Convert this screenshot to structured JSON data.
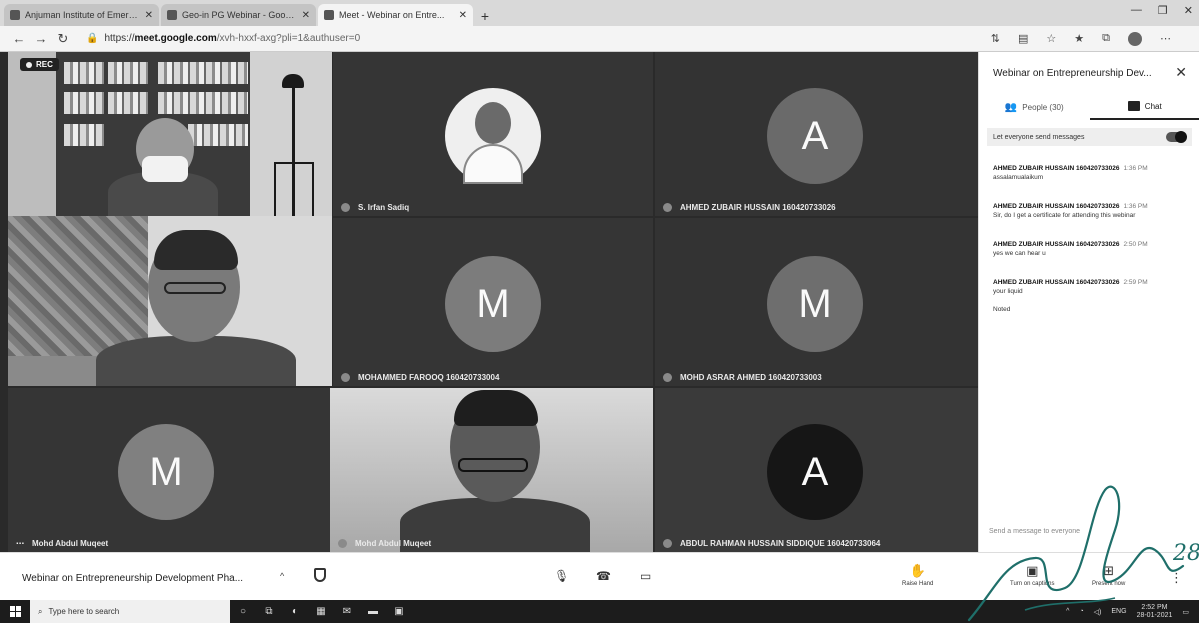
{
  "browser": {
    "tabs": [
      {
        "label": "Anjuman Institute of Emerg...",
        "active": false
      },
      {
        "label": "Geo-in PG Webinar - Google...",
        "active": false
      },
      {
        "label": "Meet - Webinar on Entre...",
        "active": true
      }
    ],
    "new_tab": "+",
    "window_controls": [
      "—",
      "❐",
      "✕"
    ],
    "nav": {
      "back": "←",
      "forward": "→",
      "reload": "↻"
    },
    "url_scheme": "https://",
    "url_host": "meet.google.com",
    "url_path": "/xvh-hxxf-axg?pli=1&authuser=0"
  },
  "stage": {
    "rec_label": "REC",
    "tiles": [
      {
        "name": ""
      },
      {
        "name": "S. Irfan Sadiq"
      },
      {
        "name": "AHMED ZUBAIR HUSSAIN 160420733026",
        "initial": "A"
      },
      {
        "name": ""
      },
      {
        "name": "MOHAMMED FAROOQ 160420733004",
        "initial": "M"
      },
      {
        "name": "MOHD ASRAR AHMED 160420733003",
        "initial": "M"
      },
      {
        "name": "Mohd Abdul Muqeet",
        "initial": "M"
      },
      {
        "name": "Mohd Abdul Muqeet"
      },
      {
        "name": "ABDUL RAHMAN HUSSAIN SIDDIQUE 160420733064",
        "initial": "A"
      }
    ]
  },
  "panel": {
    "title": "Webinar on Entrepreneurship Dev...",
    "close": "✕",
    "tab_people": "People (30)",
    "tab_chat": "Chat",
    "toggle_label": "Let everyone send messages",
    "messages": [
      {
        "sender": "AHMED ZUBAIR HUSSAIN 160420733026",
        "time": "1:36 PM",
        "text": "assalamualaikum"
      },
      {
        "sender": "AHMED ZUBAIR HUSSAIN 160420733026",
        "time": "1:36 PM",
        "text": "Sir, do I get a certificate for attending this webinar"
      },
      {
        "sender": "AHMED ZUBAIR HUSSAIN 160420733026",
        "time": "2:50 PM",
        "text": "yes we can hear u"
      },
      {
        "sender": "AHMED ZUBAIR HUSSAIN 160420733026",
        "time": "2:59 PM",
        "text": "your liquid"
      },
      {
        "sender": "",
        "time": "",
        "text": "Noted"
      }
    ],
    "input_placeholder": "Send a message to everyone"
  },
  "bottom": {
    "meeting_title": "Webinar on Entrepreneurship Development Pha...",
    "chevron": "^",
    "raise_hand": "Raise Hand",
    "captions": "Turn on captions",
    "present": "Present now",
    "more": "⋮"
  },
  "taskbar": {
    "search_placeholder": "Type here to search",
    "time": "2:52 PM",
    "date": "28-01-2021",
    "lang": "ENG"
  },
  "signature_text": "28"
}
